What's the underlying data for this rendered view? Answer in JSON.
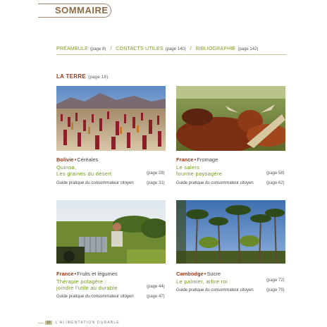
{
  "header": {
    "title": "SOMMAIRE"
  },
  "intro": [
    {
      "label": "PRÉAMBULE",
      "page": "(page 8)"
    },
    {
      "label": "CONTACTS UTILES",
      "page": "(page 140)"
    },
    {
      "label": "BIBLIOGRAPHIE",
      "page": "(page 142)"
    }
  ],
  "separator": "/",
  "section": {
    "title": "LA TERRE",
    "page": "(page 18)"
  },
  "articles": [
    {
      "country": "Bolivie",
      "theme": "Céréales",
      "headline1": "Quinoa,",
      "headline2": "Les graines du désert",
      "headline_page": "(page 28)",
      "guide": "Guide pratique du consommateur citoyen",
      "guide_page": "(page 31)",
      "photo": "quinoa-field-photo"
    },
    {
      "country": "France",
      "theme": "Fromage",
      "headline1": "Le salers",
      "headline2": "fourme paysagère",
      "headline_page": "(page 58)",
      "guide": "Guide pratique du consommateur citoyen",
      "guide_page": "(page 62)",
      "photo": "salers-cattle-photo"
    },
    {
      "country": "France",
      "theme": "Fruits et légumes",
      "headline1": "Thérapie potagère :",
      "headline2": "joindre l'utile au durable",
      "headline_page": "(page 44)",
      "guide": "Guide pratique du consommateur citoyen",
      "guide_page": "(page 47)",
      "photo": "vegetable-garden-photo"
    },
    {
      "country": "Cambodge",
      "theme": "Sucre",
      "headline1": "Le palmier, arbre roi",
      "headline2": "",
      "headline_page": "(page 72)",
      "guide": "Guide pratique du consommateur citoyen",
      "guide_page": "(page 75)",
      "photo": "palm-trees-photo"
    }
  ],
  "bullet": "•",
  "footer": {
    "page_number": "10",
    "running_title": "L'ALIMENTATION DURABLE"
  },
  "colors": {
    "accent_green": "#6f9a1c",
    "accent_red": "#9c3a1a",
    "title_brown": "#8c6a45"
  }
}
